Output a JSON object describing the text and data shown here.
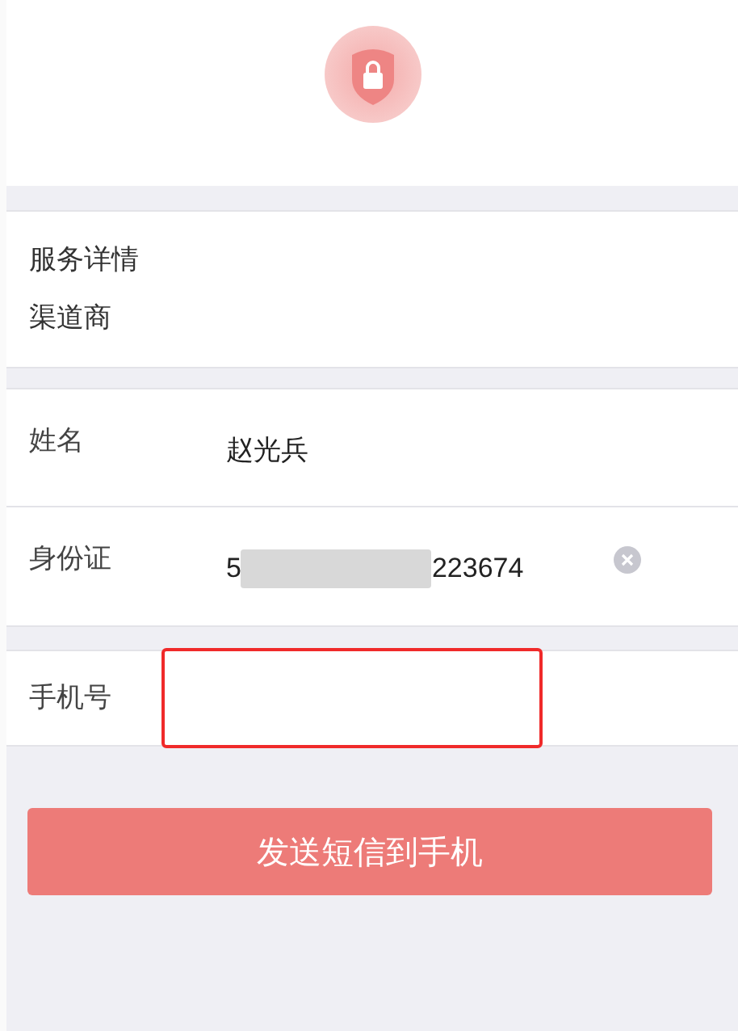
{
  "service": {
    "title": "服务详情",
    "subtitle": "渠道商"
  },
  "fields": [
    {
      "label": "姓名",
      "kind": "text",
      "value": "赵光兵"
    },
    {
      "label": "身份证",
      "kind": "masked",
      "prefix": "5",
      "suffix": "223674",
      "clearable": true
    }
  ],
  "phone": {
    "label": "手机号",
    "highlighted": true
  },
  "submit": {
    "label": "发送短信到手机"
  }
}
